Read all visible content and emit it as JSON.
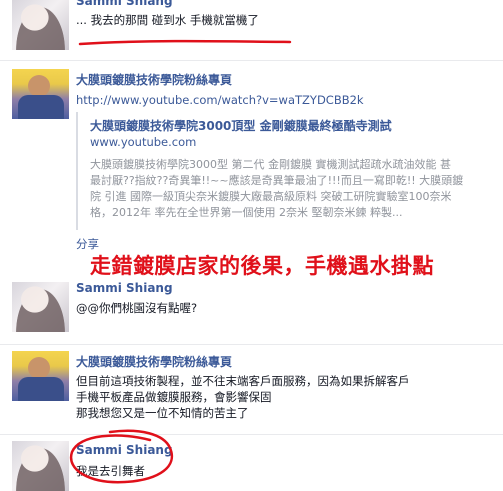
{
  "thread": [
    {
      "author": "Sammi Shiang",
      "text": "... 我去的那間 碰到水 手機就當機了"
    },
    {
      "author": "大膜頭鍍膜技術學院粉絲專頁",
      "url": "http://www.youtube.com/watch?v=waTZYDCBB2k",
      "preview": {
        "title": "大膜頭鍍膜技術學院3000頂型 金剛鍍膜最終極酷寺測試",
        "domain": "www.youtube.com",
        "desc_lines": [
          "大膜頭鍍膜技術學院3000型 第二代 金剛鍍膜 實機測試超疏水疏油效能 甚",
          "最討厭??指紋??奇異筆!!~~應該是奇異筆最油了!!!而且一寫即乾!! 大膜頭鍍",
          "院 引進 國際一級頂尖奈米鍍膜大廠最高級原料 突破工研院實驗室100奈米",
          "格，2012年 率先在全世界第一個使用 2奈米 堅韌奈米鍊 粹製..."
        ]
      },
      "share_label": "分享"
    },
    {
      "author": "Sammi Shiang",
      "text": "@@你們桃園沒有點喔?"
    },
    {
      "author": "大膜頭鍍膜技術學院粉絲專頁",
      "text_lines": [
        "但目前這項技術製程，並不往末端客戶面服務，因為如果拆解客戶",
        "手機平板產品做鍍膜服務，會影響保固",
        "那我想您又是一位不知情的苦主了"
      ]
    },
    {
      "author": "Sammi Shiang",
      "text": "我是去引舞者"
    }
  ],
  "overlay_caption": "走錯鍍膜店家的後果，手機遇水掛點",
  "colors": {
    "link": "#3b5998",
    "annotation": "#e0101a",
    "muted": "#90949c"
  }
}
